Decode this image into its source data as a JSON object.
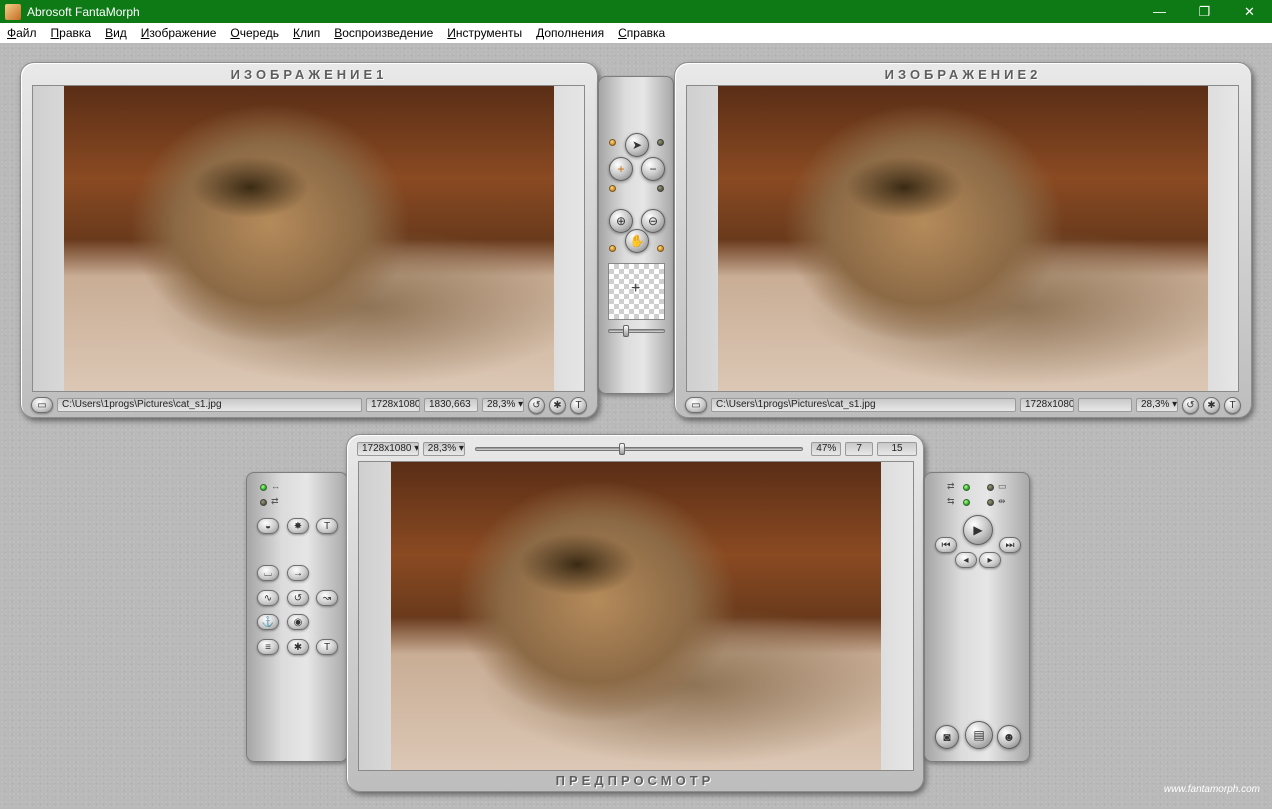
{
  "window": {
    "title": "Abrosoft FantaMorph",
    "controls": {
      "minimize": "—",
      "maximize": "❐",
      "close": "✕"
    }
  },
  "menu": [
    "Файл",
    "Правка",
    "Вид",
    "Изображение",
    "Очередь",
    "Клип",
    "Воспроизведение",
    "Инструменты",
    "Дополнения",
    "Справка"
  ],
  "image1": {
    "title": "ИЗОБРАЖЕНИЕ1",
    "path": "C:\\Users\\1progs\\Pictures\\cat_s1.jpg",
    "size": "1728x1080",
    "coords": "1830,663",
    "zoom": "28,3%"
  },
  "image2": {
    "title": "ИЗОБРАЖЕНИЕ2",
    "path": "C:\\Users\\1progs\\Pictures\\cat_s1.jpg",
    "size": "1728x1080",
    "coords": "",
    "zoom": "28,3%"
  },
  "preview": {
    "title": "ПРЕДПРОСМОТР",
    "size": "1728x1080",
    "zoom": "28,3%",
    "progress": "47%",
    "frame": "7",
    "total_frames": "15",
    "timeline_position": 0.5
  },
  "footer": {
    "site": "www.fantamorph.com"
  },
  "colors": {
    "titlebar": "#0d7a16",
    "led_on": "#1fa31f",
    "led_orange": "#d48a1a"
  }
}
